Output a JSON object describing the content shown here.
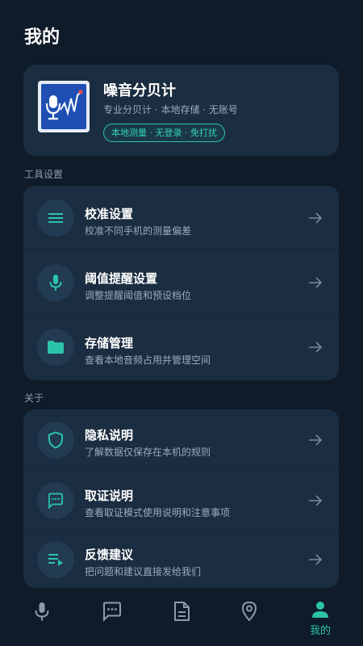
{
  "page": {
    "title": "我的"
  },
  "profile": {
    "name": "噪音分贝计",
    "subtitle": "专业分贝计 · 本地存储 · 无账号",
    "badge": "本地测量 · 无登录 · 免打扰"
  },
  "sections": {
    "tools": {
      "label": "工具设置",
      "items": [
        {
          "title": "校准设置",
          "desc": "校准不同手机的测量偏差",
          "icon": "menu-lines-icon"
        },
        {
          "title": "阈值提醒设置",
          "desc": "调整提醒阈值和预设档位",
          "icon": "microphone-icon"
        },
        {
          "title": "存储管理",
          "desc": "查看本地音频占用并管理空间",
          "icon": "folder-icon"
        }
      ]
    },
    "about": {
      "label": "关于",
      "items": [
        {
          "title": "隐私说明",
          "desc": "了解数据仅保存在本机的规则",
          "icon": "shield-icon"
        },
        {
          "title": "取证说明",
          "desc": "查看取证模式使用说明和注意事项",
          "icon": "message-icon"
        },
        {
          "title": "反馈建议",
          "desc": "把问题和建议直接发给我们",
          "icon": "feedback-list-icon"
        }
      ]
    }
  },
  "tabbar": {
    "active_label": "我的",
    "tabs": [
      "microphone-icon",
      "chat-icon",
      "document-icon",
      "location-pin-icon",
      "person-icon"
    ]
  },
  "colors": {
    "background": "#0f1b28",
    "card": "#1b2d40",
    "accent": "#2bc4a8",
    "icon_circle": "#223a52"
  }
}
